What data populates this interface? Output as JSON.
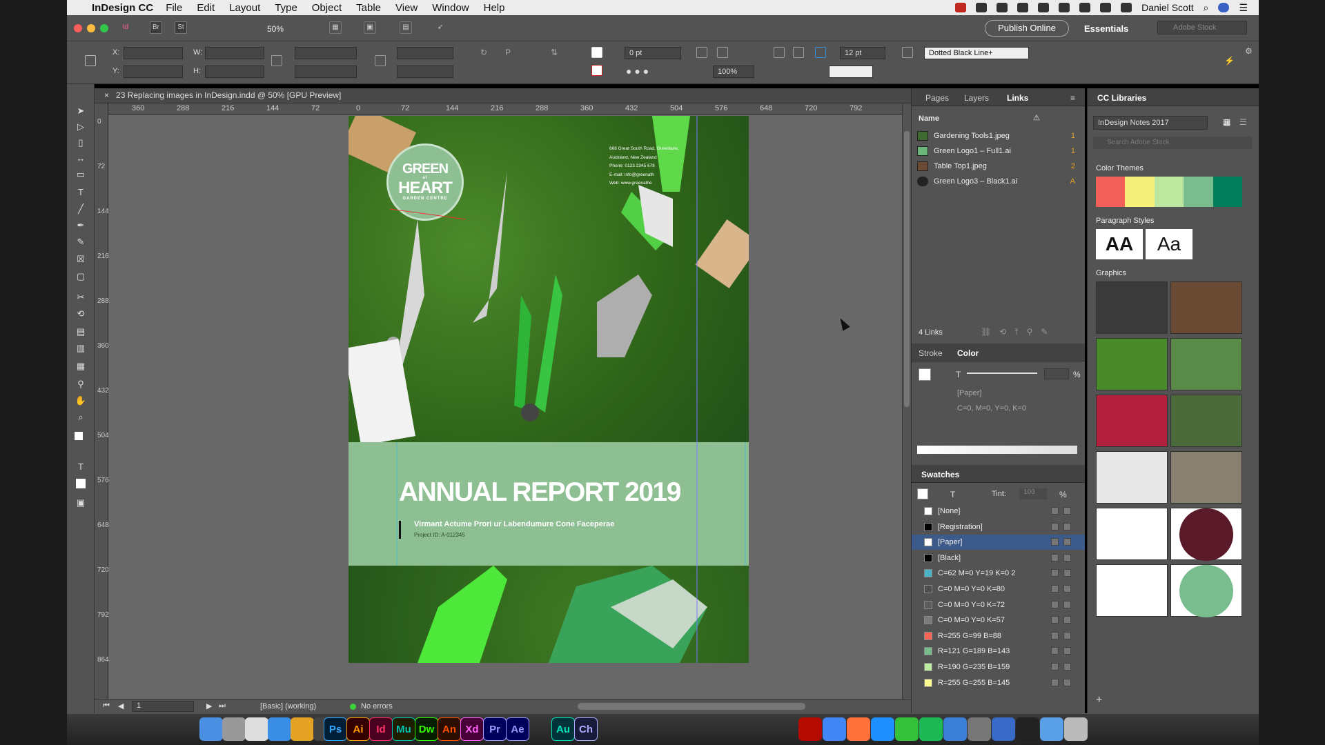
{
  "menubar": {
    "app": "InDesign CC",
    "items": [
      "File",
      "Edit",
      "Layout",
      "Type",
      "Object",
      "Table",
      "View",
      "Window",
      "Help"
    ],
    "user": "Daniel Scott"
  },
  "appbar": {
    "zoom": "50%",
    "publish": "Publish Online",
    "workspace": "Essentials",
    "stock_placeholder": "Adobe Stock"
  },
  "control": {
    "x_label": "X:",
    "y_label": "Y:",
    "w_label": "W:",
    "h_label": "H:",
    "stroke_weight": "0 pt",
    "scale": "100%",
    "stroke_style": "Dotted Black Line+",
    "size": "12 pt"
  },
  "document": {
    "tab": "23 Replacing images in InDesign.indd @ 50% [GPU Preview]",
    "close": "×"
  },
  "ruler_h": [
    "360",
    "288",
    "216",
    "144",
    "72",
    "0",
    "72",
    "144",
    "216",
    "288",
    "360",
    "432",
    "504",
    "576",
    "648",
    "720",
    "792"
  ],
  "ruler_v": [
    "0",
    "72",
    "144",
    "216",
    "288",
    "360",
    "432",
    "504",
    "576",
    "648",
    "720",
    "792",
    "864"
  ],
  "page": {
    "title": "ANNUAL REPORT 2019",
    "subtitle": "Virmant Actume Prori ur Labendumure Cone Faceperae",
    "project": "Project ID: A-012345",
    "logo_top": "GREEN",
    "logo_at": "at",
    "logo_bottom": "HEART",
    "logo_ring": "GARDEN CENTRE",
    "address": [
      "666 Great South Road, Greenlane,",
      "Auckland, New Zealand",
      "Phone: 0123 2345 678",
      "E-mail: info@greenath",
      "Web: www.greenathe"
    ]
  },
  "status": {
    "page": "1",
    "style": "[Basic] (working)",
    "errors": "No errors"
  },
  "links_panel": {
    "tabs": [
      "Pages",
      "Layers",
      "Links"
    ],
    "header": "Name",
    "links": [
      {
        "name": "Gardening Tools1.jpeg",
        "page": "1"
      },
      {
        "name": "Green Logo1 – Full1.ai",
        "page": "1"
      },
      {
        "name": "Table Top1.jpeg",
        "page": "2"
      },
      {
        "name": "Green Logo3 – Black1.ai",
        "page": "A"
      }
    ],
    "count": "4 Links"
  },
  "color_panel": {
    "tabs": [
      "Stroke",
      "Color"
    ],
    "t": "T",
    "pct": "%",
    "swatch_name": "[Paper]",
    "values": "C=0, M=0, Y=0, K=0"
  },
  "swatches_panel": {
    "title": "Swatches",
    "tint_label": "Tint:",
    "tint": "100",
    "pct": "%",
    "t": "T",
    "swatches": [
      {
        "name": "[None]",
        "color": "#ffffff"
      },
      {
        "name": "[Registration]",
        "color": "#000000"
      },
      {
        "name": "[Paper]",
        "color": "#ffffff"
      },
      {
        "name": "[Black]",
        "color": "#000000"
      },
      {
        "name": "C=62 M=0 Y=19 K=0 2",
        "color": "#4bb4c8"
      },
      {
        "name": "C=0 M=0 Y=0 K=80",
        "color": "#4d4d4d"
      },
      {
        "name": "C=0 M=0 Y=0 K=72",
        "color": "#5c5c5c"
      },
      {
        "name": "C=0 M=0 Y=0 K=57",
        "color": "#7a7a7a"
      },
      {
        "name": "R=255 G=99 B=88",
        "color": "#ff6358"
      },
      {
        "name": "R=121 G=189 B=143",
        "color": "#79bd8f"
      },
      {
        "name": "R=190 G=235 B=159",
        "color": "#beeb9f"
      },
      {
        "name": "R=255 G=255 B=145",
        "color": "#ffff91"
      }
    ]
  },
  "cc_libraries": {
    "title": "CC Libraries",
    "library": "InDesign Notes 2017",
    "search_placeholder": "Search Adobe Stock",
    "color_themes_label": "Color Themes",
    "theme_colors": [
      "#f2605a",
      "#f5f07c",
      "#bde69f",
      "#79bd8f",
      "#007e5c"
    ],
    "para_label": "Paragraph Styles",
    "para": [
      "AA",
      "Aa"
    ],
    "graphics_label": "Graphics"
  },
  "dock": [
    "Ps",
    "Ai",
    "Id",
    "Mu",
    "Dw",
    "An",
    "Xd",
    "Pr",
    "Ae",
    "Au",
    "Ch"
  ]
}
